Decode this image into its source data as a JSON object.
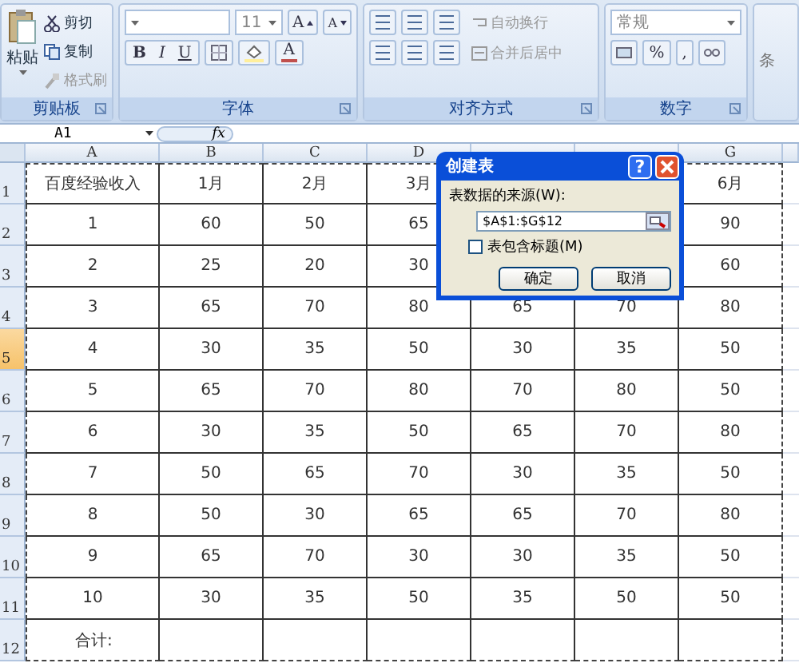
{
  "clipboard": {
    "title": "剪贴板",
    "paste": "粘贴",
    "actions": [
      {
        "label": "剪切",
        "kind": "cut",
        "disabled": false
      },
      {
        "label": "复制",
        "kind": "copy",
        "disabled": false
      },
      {
        "label": "格式刷",
        "kind": "brush",
        "disabled": true
      }
    ]
  },
  "font": {
    "title": "字体",
    "size": "11",
    "grow": "A",
    "shrink": "A",
    "styles": [
      "B",
      "I",
      "U"
    ],
    "color_letter": "A"
  },
  "alignment": {
    "title": "对齐方式",
    "wrap": "自动换行",
    "merge": "合并后居中"
  },
  "number": {
    "title": "数字",
    "format": "常规",
    "percent": "%",
    "comma": ","
  },
  "styles": {
    "label": "条"
  },
  "formula_bar": {
    "name_box": "A1",
    "function_label": "fx"
  },
  "sheet": {
    "columns": [
      "A",
      "B",
      "C",
      "D",
      null,
      null,
      "G"
    ],
    "rows": [
      {
        "header": "1",
        "selected": false,
        "cells": [
          "百度经验收入",
          "1月",
          "2月",
          "3月",
          null,
          null,
          "6月"
        ]
      },
      {
        "header": "2",
        "selected": false,
        "cells": [
          "1",
          "60",
          "50",
          "65",
          null,
          null,
          "90"
        ]
      },
      {
        "header": "3",
        "selected": false,
        "cells": [
          "2",
          "25",
          "20",
          "30",
          null,
          null,
          "60"
        ]
      },
      {
        "header": "4",
        "selected": false,
        "cells": [
          "3",
          "65",
          "70",
          "80",
          "65",
          "70",
          "80"
        ]
      },
      {
        "header": "5",
        "selected": true,
        "cells": [
          "4",
          "30",
          "35",
          "50",
          "30",
          "35",
          "50"
        ]
      },
      {
        "header": "6",
        "selected": false,
        "cells": [
          "5",
          "65",
          "70",
          "80",
          "70",
          "80",
          "50"
        ]
      },
      {
        "header": "7",
        "selected": false,
        "cells": [
          "6",
          "30",
          "35",
          "50",
          "65",
          "70",
          "80"
        ]
      },
      {
        "header": "8",
        "selected": false,
        "cells": [
          "7",
          "50",
          "65",
          "70",
          "30",
          "35",
          "50"
        ]
      },
      {
        "header": "9",
        "selected": false,
        "cells": [
          "8",
          "50",
          "30",
          "65",
          "65",
          "70",
          "80"
        ]
      },
      {
        "header": "10",
        "selected": false,
        "cells": [
          "9",
          "65",
          "70",
          "30",
          "30",
          "35",
          "50"
        ]
      },
      {
        "header": "11",
        "selected": false,
        "cells": [
          "10",
          "30",
          "35",
          "50",
          "35",
          "50",
          "50"
        ]
      },
      {
        "header": "12",
        "selected": false,
        "cells": [
          "合计:",
          null,
          null,
          null,
          null,
          null,
          null
        ]
      }
    ]
  },
  "dialog": {
    "title": "创建表",
    "help": "?",
    "source_label": "表数据的来源(W):",
    "range": "$A$1:$G$12",
    "header_checkbox": {
      "label": "表包含标题(M)",
      "checked": false
    },
    "buttons": [
      "确定",
      "取消"
    ]
  }
}
